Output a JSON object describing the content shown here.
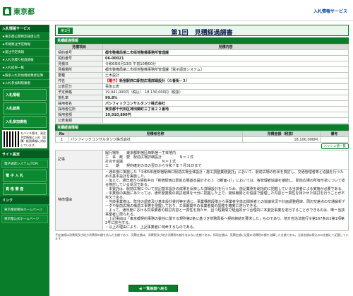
{
  "header": {
    "logo": "東京都",
    "site_title": "入札情報サービス"
  },
  "sidebar": {
    "title": "入札情報サービス",
    "items": [
      "★東京都公開特定調達公告",
      "★年間発注予定情報",
      "★発注予定情報",
      "★入札見積り経過情報",
      "★入札結果一覧",
      "★競争入札参加資格業者名簿",
      "★入札参加制限業者"
    ],
    "buttons": [
      "入札情報",
      "入札結果",
      "入札参加資格"
    ],
    "note_text": "モバイル版は、発注予定情報と入札（見積）経過情報に対応しています。",
    "section2": "サイト設定",
    "links": [
      "電子調達システム(TOP)",
      "電 子 入 札",
      "資 格 審 査"
    ],
    "section3": "リンク",
    "ext_links": [
      "東京都財務局ホームページ",
      "東京都公式ホームページ"
    ]
  },
  "page": {
    "badge": "第1回",
    "title": "第1回　見積経過調書"
  },
  "info": {
    "section_label": "見積経過情報",
    "col1": "見積項目",
    "col2": "見積内容",
    "rows": [
      {
        "k": "契約番号",
        "v": "都市整備局第二市街地整備事務所管理課"
      },
      {
        "k": "契約番号",
        "v": "06-00021"
      },
      {
        "k": "見積日",
        "v": "令和6年6月13日 午前10時00分"
      },
      {
        "k": "見積場所",
        "v": "都市整備局第二市街地整備事務所管理課［電子調達システム］"
      },
      {
        "k": "業種",
        "v": "土木設計"
      },
      {
        "k": "件名",
        "prefix": "【電子】",
        "v": "新宿駅西口駅前広場詳細設計（６番街−３）"
      },
      {
        "k": "公表区分",
        "v": "事後公表"
      },
      {
        "k": "予定価格",
        "v": "19,941,000円（税込）　18,130,000円（税抜）"
      },
      {
        "k": "落札率",
        "v": "99.8%"
      },
      {
        "k": "採用者名",
        "v": "パシフィックコンサルタンツ株式会社"
      },
      {
        "k": "採用者住所",
        "v": "東京都千代田区神田錦町三丁目２２番地"
      },
      {
        "k": "採用金額",
        "v": "19,910,800円"
      },
      {
        "k": "公表金額",
        "v": ""
      }
    ]
  },
  "result": {
    "section_label": "見積経過情報",
    "cols": [
      "No",
      "見積者名称",
      "見積金額（税抜）",
      "備考"
    ],
    "rows": [
      {
        "no": "1",
        "name": "パシフィックコンサルタンツ株式会社",
        "amount": "18,100,000円",
        "note": ""
      }
    ],
    "print_label": "ハッシュ値一覧"
  },
  "notes": {
    "k1": "記事",
    "v1": [
      "履行場所　　東京都新宿区西新宿一丁目地内",
      "工　事　概　要　駅前広場詳細設計　　　　　Ｎ＝１式",
      "打合せ協議　　　　　　　　　　　Ｎ＝１式",
      "工　　期　　契約確定の日の翌日から令和７年７月31日まで"
    ],
    "k2": "特命理由",
    "v2": [
      "・通年度に実施した「令和5年度新宿駅西口駅前広場全体設計・施工調整業務委託」において、駅前広場の形状を検討し、交通管理者等と協議を行うための基本設計を実施した。",
      "・加えて、通年度から契約中の「新宿駅西口駅前広場基本設計その３（3断面-2）」においては、各管理者協議を継続し、駅前広場の所有形状について総合検討している状況である。",
      "・本委託は、駅前広場について前記基本設計の成果を反映した詳細設計を行うため、前記業務を総括的に把握している当該者による実施が必要である。",
      "・本業務の実施にあたっては、通年度業務の検討結果を十分に把握した上で、関係機関との協議で整理した内容と一貫性を持たせた検討を行うことが不可欠である。",
      "・当該事業者は、既往の調査及び基本設計委託等を通じ、事業構想段階から事業者全体の関係者との協議状況や計画調整経緯、周辺交差点の交通解析データや駅前広場の構造工事等を把握しており、工事期間中の事業者間の調整を確実に遂行できる。",
      "・よって、通年度における同事業者の検討内容と一貫性を持たせ、且つ短期間で経過的かつ合理的に本委託事業を遂行することができるのは、唯一当該事業者に限られる。",
      "・上記事由は「東京都契約事務の委任に関する規則第2条に基づき財務局長へ契約締結を要求した」ものであり、地方自治法施行令第167条の2第1項第2号に該当する。",
      "・以上の理由により、上記事業者に特命するものである。"
    ]
  },
  "footer": {
    "note": "予定価格は消費税及び地方消費税の額を含んだ金額であり、見積金額は、消費税及び地方消費税の額を含まない金額である。採用金額は、見積金額に記載の消費税の額を加算した金額である。当該金額は税込みの金額にて記載しています。",
    "back": "◀ 一覧画面へ戻る"
  }
}
